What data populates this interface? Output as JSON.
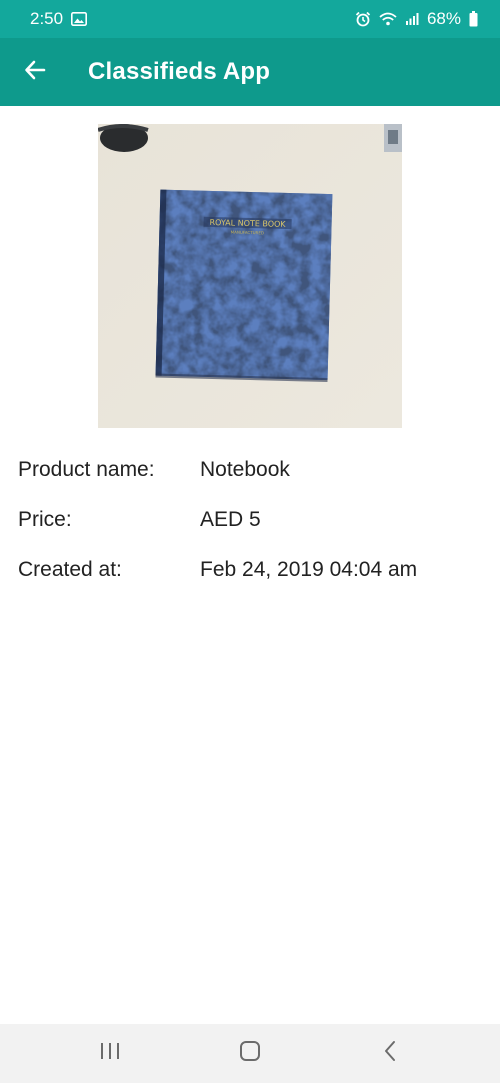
{
  "status_bar": {
    "time": "2:50",
    "battery_percent": "68%",
    "icons": [
      "image-icon",
      "alarm-icon",
      "wifi-icon",
      "signal-icon",
      "battery-icon"
    ]
  },
  "app_bar": {
    "title": "Classifieds App",
    "back_icon": "arrow-left-icon",
    "background_color": "#0e9a8c"
  },
  "product": {
    "details": [
      {
        "label": "Product name:",
        "value": "Notebook"
      },
      {
        "label": "Price:",
        "value": "AED 5"
      },
      {
        "label": "Created at:",
        "value": "Feb 24, 2019 04:04 am"
      }
    ]
  },
  "nav_bar": {
    "icons": [
      "recent-apps-icon",
      "home-icon",
      "back-icon"
    ]
  }
}
